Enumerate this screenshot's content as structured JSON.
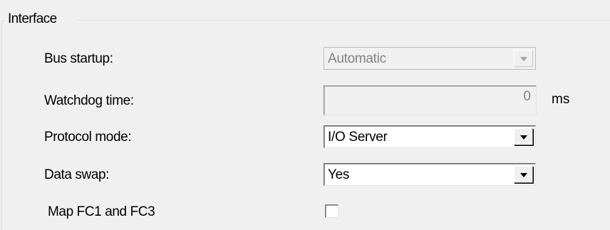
{
  "group": {
    "title": "Interface"
  },
  "fields": {
    "bus_startup": {
      "label": "Bus startup:",
      "value": "Automatic",
      "enabled": false
    },
    "watchdog_time": {
      "label": "Watchdog time:",
      "value": "0",
      "unit": "ms",
      "enabled": false
    },
    "protocol_mode": {
      "label": "Protocol mode:",
      "value": "I/O Server",
      "enabled": true
    },
    "data_swap": {
      "label": "Data swap:",
      "value": "Yes",
      "enabled": true
    },
    "map_fc1_fc3": {
      "label": "Map FC1 and FC3",
      "checked": false
    }
  },
  "icons": {
    "dropdown": "chevron-down-icon"
  },
  "colors": {
    "background": "#f0f0f0",
    "disabled_text": "#838383",
    "group_border": "#d5dfe5"
  }
}
